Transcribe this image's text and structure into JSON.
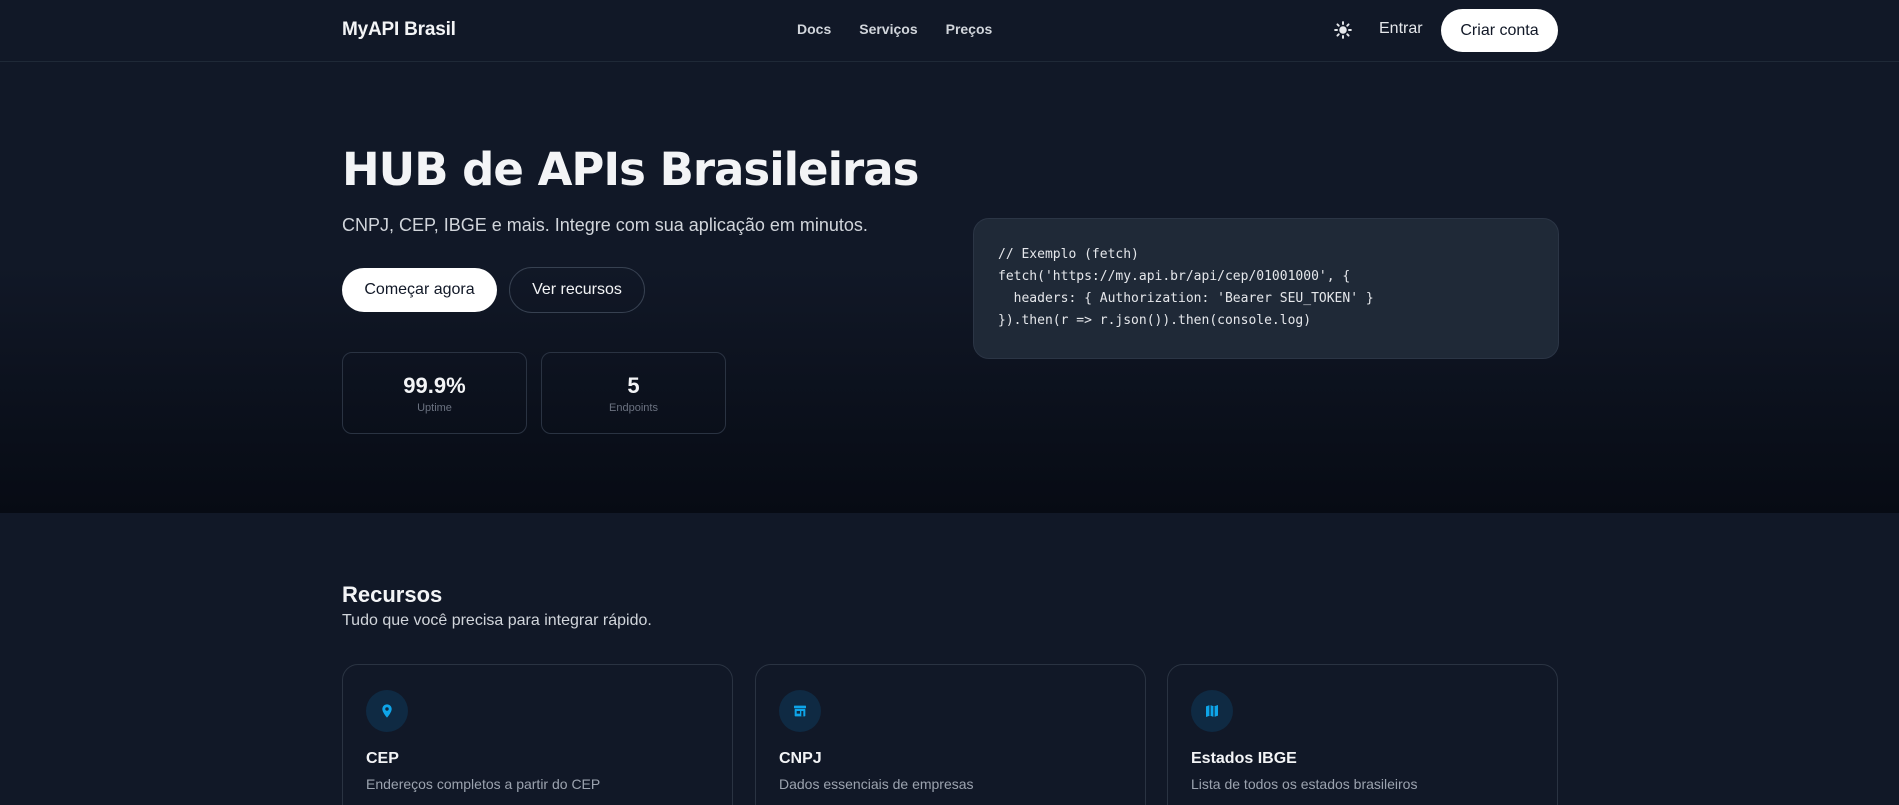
{
  "header": {
    "brand": "MyAPI Brasil",
    "nav": [
      {
        "label": "Docs"
      },
      {
        "label": "Serviços"
      },
      {
        "label": "Preços"
      }
    ],
    "theme_icon": "sun-icon",
    "login_label": "Entrar",
    "signup_label": "Criar conta"
  },
  "hero": {
    "title": "HUB de APIs Brasileiras",
    "subtitle": "CNPJ, CEP, IBGE e mais. Integre com sua aplicação em minutos.",
    "primary_cta": "Começar agora",
    "secondary_cta": "Ver recursos",
    "stats": [
      {
        "value": "99.9%",
        "label": "Uptime"
      },
      {
        "value": "5",
        "label": "Endpoints"
      }
    ],
    "code_lines": [
      "// Exemplo (fetch)",
      "fetch('https://my.api.br/api/cep/01001000', {",
      "  headers: { Authorization: 'Bearer SEU_TOKEN' }",
      "}).then(r => r.json()).then(console.log)"
    ]
  },
  "features": {
    "title": "Recursos",
    "subtitle": "Tudo que você precisa para integrar rápido.",
    "cards": [
      {
        "icon": "map-pin-icon",
        "title": "CEP",
        "description": "Endereços completos a partir do CEP"
      },
      {
        "icon": "store-icon",
        "title": "CNPJ",
        "description": "Dados essenciais de empresas"
      },
      {
        "icon": "map-icon",
        "title": "Estados IBGE",
        "description": "Lista de todos os estados brasileiros"
      }
    ]
  },
  "colors": {
    "background": "#111827",
    "accent_icon": "#0ea5e9",
    "icon_circle": "#0f2a43",
    "button_bg": "#ffffff"
  }
}
